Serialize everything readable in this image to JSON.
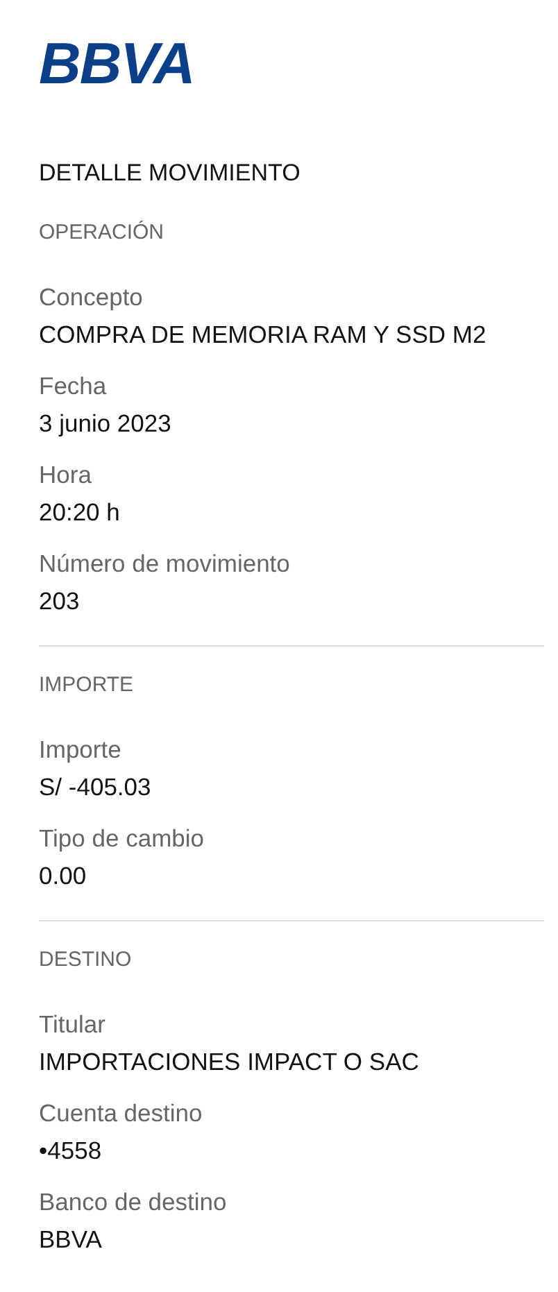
{
  "logo": "BBVA",
  "title": "DETALLE MOVIMIENTO",
  "sections": [
    {
      "header": "OPERACIÓN",
      "fields": [
        {
          "label": "Concepto",
          "value": "COMPRA DE MEMORIA RAM Y SSD M2"
        },
        {
          "label": "Fecha",
          "value": "3 junio 2023"
        },
        {
          "label": "Hora",
          "value": "20:20 h"
        },
        {
          "label": "Número de movimiento",
          "value": "203"
        }
      ]
    },
    {
      "header": "IMPORTE",
      "fields": [
        {
          "label": "Importe",
          "value": "S/ -405.03"
        },
        {
          "label": "Tipo de cambio",
          "value": "0.00"
        }
      ]
    },
    {
      "header": "DESTINO",
      "fields": [
        {
          "label": "Titular",
          "value": "IMPORTACIONES IMPACT O SAC"
        },
        {
          "label": "Cuenta destino",
          "value": "•4558"
        },
        {
          "label": "Banco de destino",
          "value": "BBVA"
        }
      ]
    }
  ]
}
